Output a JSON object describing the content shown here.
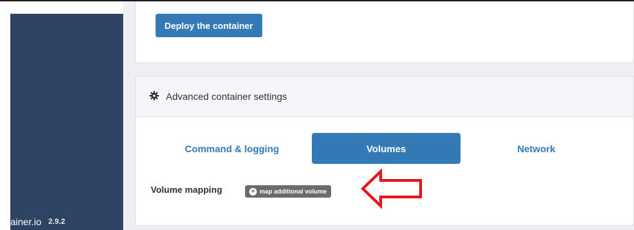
{
  "sidebar": {
    "brand": "ainer.io",
    "version": "2.9.2"
  },
  "deploy_card": {
    "deploy_button": "Deploy the container"
  },
  "advanced": {
    "title": "Advanced container settings",
    "header_icon": "gear-icon",
    "tabs": [
      {
        "label": "Command & logging",
        "active": false
      },
      {
        "label": "Volumes",
        "active": true
      },
      {
        "label": "Network",
        "active": false
      }
    ],
    "volume_mapping_label": "Volume mapping",
    "map_button": {
      "icon": "plus-circle-icon",
      "label": "map additional volume"
    }
  },
  "annotation": {
    "type": "arrow",
    "color": "#e8141c",
    "points_to": "map additional volume button"
  },
  "colors": {
    "primary": "#337ab7",
    "sidebar": "#2e4463",
    "badge": "#6b6b6b"
  }
}
